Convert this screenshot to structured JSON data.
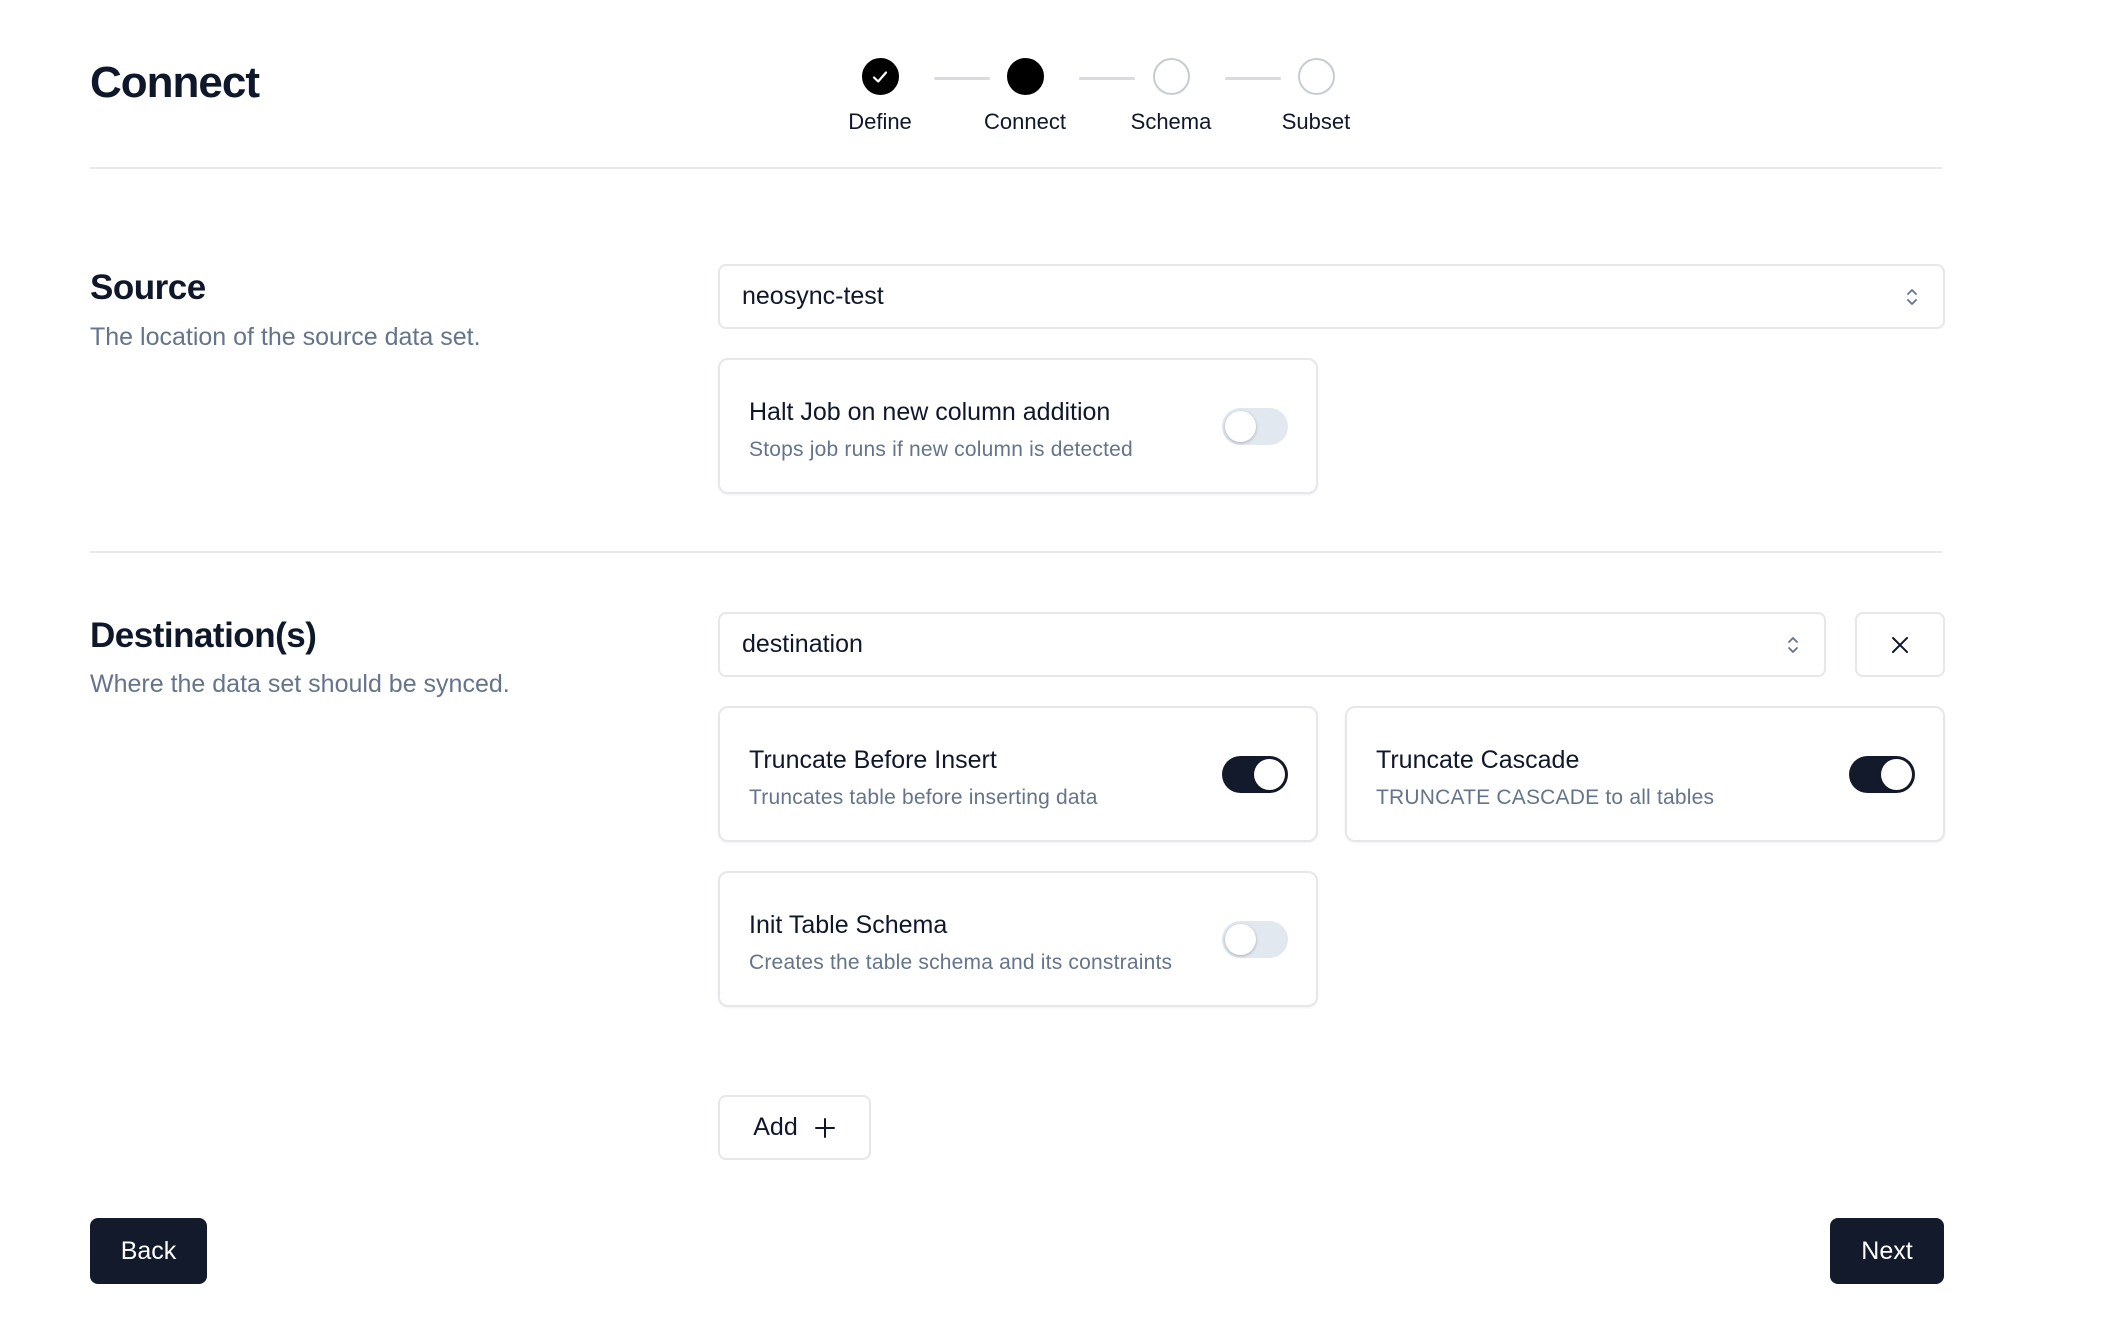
{
  "header": {
    "title": "Connect"
  },
  "stepper": {
    "steps": [
      {
        "label": "Define",
        "state": "complete"
      },
      {
        "label": "Connect",
        "state": "active"
      },
      {
        "label": "Schema",
        "state": "pending"
      },
      {
        "label": "Subset",
        "state": "pending"
      }
    ]
  },
  "source": {
    "title": "Source",
    "description": "The location of the source data set.",
    "selected": "neosync-test",
    "options": [
      {
        "title": "Halt Job on new column addition",
        "description": "Stops job runs if new column is detected",
        "enabled": false
      }
    ]
  },
  "destinations": {
    "title": "Destination(s)",
    "description": "Where the data set should be synced.",
    "selected": "destination",
    "options": [
      {
        "title": "Truncate Before Insert",
        "description": "Truncates table before inserting data",
        "enabled": true
      },
      {
        "title": "Truncate Cascade",
        "description": "TRUNCATE CASCADE to all tables",
        "enabled": true
      },
      {
        "title": "Init Table Schema",
        "description": "Creates the table schema and its constraints",
        "enabled": false
      }
    ],
    "add_label": "Add"
  },
  "footer": {
    "back_label": "Back",
    "next_label": "Next"
  },
  "colors": {
    "primary": "#131a2b",
    "border": "#e5e7eb",
    "muted_text": "#64748b",
    "toggle_off": "#e2e8f0"
  },
  "icons": [
    "check-icon",
    "chevron-up-down-icon",
    "close-icon",
    "plus-icon"
  ]
}
